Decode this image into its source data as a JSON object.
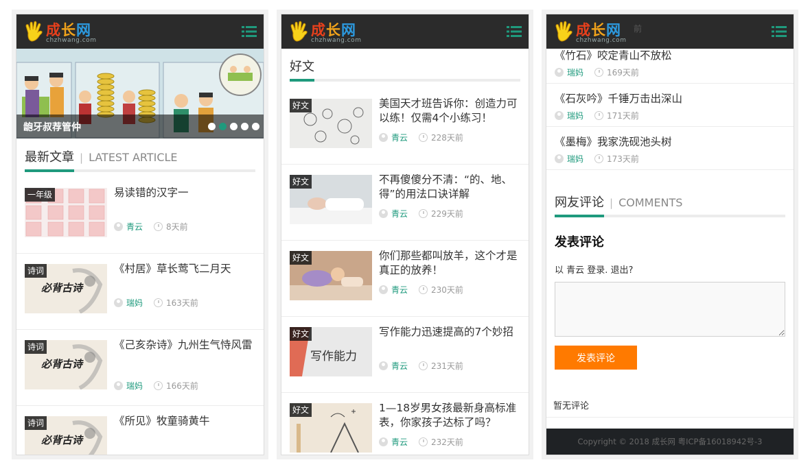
{
  "logo": {
    "brand_1": "成",
    "brand_2": "长",
    "brand_3": "网",
    "domain": "chzhwang.com"
  },
  "panel1": {
    "slider": {
      "caption": "龅牙叔荐管仲",
      "slide_count": 5,
      "active_slide": 2
    },
    "section": {
      "zh": "最新文章",
      "en": "LATEST ARTICLE"
    },
    "articles": [
      {
        "tag": "一年级",
        "title": "易读错的汉字一",
        "author": "青云",
        "time": "8天前"
      },
      {
        "tag": "诗词",
        "title": "《村居》草长莺飞二月天",
        "author": "瑞妈",
        "time": "163天前"
      },
      {
        "tag": "诗词",
        "title": "《己亥杂诗》九州生气恃风雷",
        "author": "瑞妈",
        "time": "166天前"
      },
      {
        "tag": "诗词",
        "title": "《所见》牧童骑黄牛",
        "author": "",
        "time": ""
      }
    ],
    "thumb_text": "必背古诗"
  },
  "panel2": {
    "section": {
      "zh": "好文"
    },
    "articles": [
      {
        "tag": "好文",
        "title": "美国天才班告诉你：创造力可以练！仅需4个小练习！",
        "author": "青云",
        "time": "228天前"
      },
      {
        "tag": "好文",
        "title": "不再傻傻分不清：“的、地、得”的用法口诀详解",
        "author": "青云",
        "time": "229天前"
      },
      {
        "tag": "好文",
        "title": "你们那些都叫放羊，这个才是真正的放养！",
        "author": "青云",
        "time": "230天前"
      },
      {
        "tag": "好文",
        "title": "写作能力迅速提高的7个妙招",
        "author": "青云",
        "time": "231天前",
        "thumb_text": "写作能力"
      },
      {
        "tag": "好文",
        "title": "1—18岁男女孩最新身高标准表，你家孩子达标了吗？",
        "author": "青云",
        "time": "232天前"
      }
    ]
  },
  "panel3": {
    "hidden_time": "前",
    "items": [
      {
        "title": "《竹石》咬定青山不放松",
        "author": "瑞妈",
        "time": "169天前"
      },
      {
        "title": "《石灰吟》千锤万击出深山",
        "author": "瑞妈",
        "time": "171天前"
      },
      {
        "title": "《墨梅》我家洗砚池头树",
        "author": "瑞妈",
        "time": "173天前"
      }
    ],
    "section": {
      "zh": "网友评论",
      "en": "COMMENTS"
    },
    "comment": {
      "title": "发表评论",
      "login_text": "以 青云 登录. 退出?",
      "button": "发表评论",
      "empty": "暂无评论"
    },
    "footer": "Copyright © 2018 成长网 粤ICP备16018942号-3"
  },
  "colors": {
    "accent": "#1f9a7d",
    "button": "#ff7a00",
    "topbar": "#2b2b2b"
  }
}
